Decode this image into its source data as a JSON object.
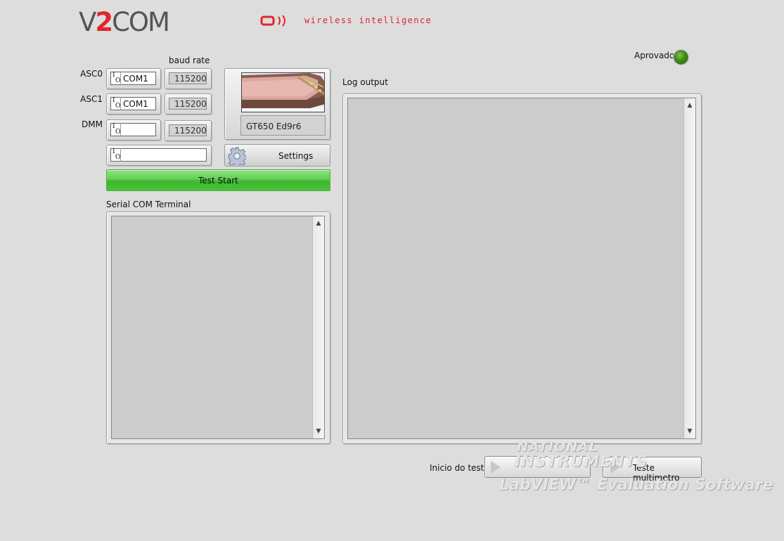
{
  "header": {
    "logo_prefix": "V",
    "logo_digit": "2",
    "logo_suffix": "COM",
    "tagline": "wireless intelligence"
  },
  "ports": {
    "baud_rate_label": "baud rate",
    "rows": [
      {
        "label": "ASC0",
        "com": "COM1",
        "baud": "115200"
      },
      {
        "label": "ASC1",
        "com": "COM1",
        "baud": "115200"
      },
      {
        "label": "DMM",
        "com": "",
        "baud": "115200"
      }
    ],
    "extra_com": ""
  },
  "device": {
    "name": "GT650 Ed9r6"
  },
  "settings_label": "Settings",
  "test_start_label": "Test Start",
  "serial_terminal_label": "Serial COM Terminal",
  "log_output_label": "Log output",
  "status": {
    "label": "Aprovado",
    "led_color": "#3f8e12"
  },
  "bottom": {
    "inicio_label": "Inicio do teste",
    "teste_multimetro_label": "Teste multimetro"
  },
  "watermark": {
    "line1": "NATIONAL",
    "line2": "INSTRUMENTS",
    "line3": "LabVIEW™ Evaluation Software"
  },
  "colors": {
    "brand_red": "#e3242b",
    "test_start_green": "#46c43a"
  }
}
